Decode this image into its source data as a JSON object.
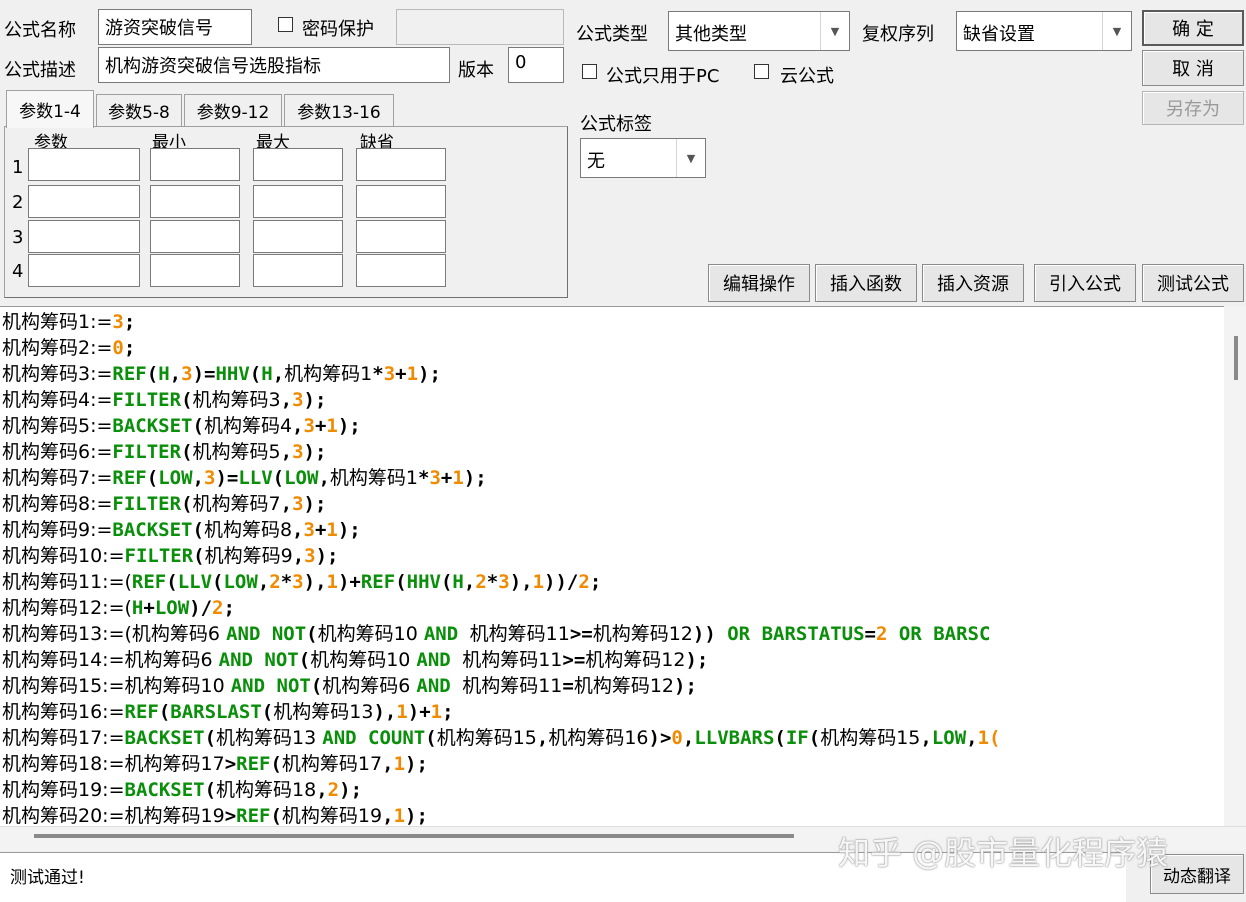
{
  "form": {
    "name_label": "公式名称",
    "name_value": "游资突破信号",
    "password_label": "密码保护",
    "password_checked": false,
    "desc_label": "公式描述",
    "desc_value": "机构游资突破信号选股指标",
    "version_label": "版本",
    "version_value": "0",
    "type_label": "公式类型",
    "type_value": "其他类型",
    "rights_label": "复权序列",
    "rights_value": "缺省设置",
    "pc_only_label": "公式只用于PC",
    "pc_only_checked": false,
    "cloud_label": "云公式",
    "cloud_checked": false,
    "tag_label": "公式标签",
    "tag_value": "无"
  },
  "buttons": {
    "ok": "确  定",
    "cancel": "取  消",
    "save_as": "另存为",
    "edit_ops": "编辑操作",
    "insert_func": "插入函数",
    "insert_res": "插入资源",
    "import_formula": "引入公式",
    "test_formula": "测试公式",
    "dynamic_translate": "动态翻译"
  },
  "tabs": [
    "参数1-4",
    "参数5-8",
    "参数9-12",
    "参数13-16"
  ],
  "params": {
    "headers": [
      "参数",
      "最小",
      "最大",
      "缺省"
    ],
    "rows": [
      "1",
      "2",
      "3",
      "4"
    ]
  },
  "code_lines": [
    [
      [
        "t",
        "机构筹码1:="
      ],
      [
        "n",
        "3"
      ],
      [
        "o",
        ";"
      ]
    ],
    [
      [
        "t",
        "机构筹码2:="
      ],
      [
        "n",
        "0"
      ],
      [
        "o",
        ";"
      ]
    ],
    [
      [
        "t",
        "机构筹码3:="
      ],
      [
        "f",
        "REF"
      ],
      [
        "o",
        "("
      ],
      [
        "f",
        "H"
      ],
      [
        "o",
        ","
      ],
      [
        "n",
        "3"
      ],
      [
        "o",
        ")="
      ],
      [
        "f",
        "HHV"
      ],
      [
        "o",
        "("
      ],
      [
        "f",
        "H"
      ],
      [
        "o",
        ","
      ],
      [
        "t",
        "机构筹码1"
      ],
      [
        "o",
        "*"
      ],
      [
        "n",
        "3"
      ],
      [
        "o",
        "+"
      ],
      [
        "n",
        "1"
      ],
      [
        "o",
        ");"
      ]
    ],
    [
      [
        "t",
        "机构筹码4:="
      ],
      [
        "f",
        "FILTER"
      ],
      [
        "o",
        "("
      ],
      [
        "t",
        "机构筹码3"
      ],
      [
        "o",
        ","
      ],
      [
        "n",
        "3"
      ],
      [
        "o",
        ");"
      ]
    ],
    [
      [
        "t",
        "机构筹码5:="
      ],
      [
        "f",
        "BACKSET"
      ],
      [
        "o",
        "("
      ],
      [
        "t",
        "机构筹码4"
      ],
      [
        "o",
        ","
      ],
      [
        "n",
        "3"
      ],
      [
        "o",
        "+"
      ],
      [
        "n",
        "1"
      ],
      [
        "o",
        ");"
      ]
    ],
    [
      [
        "t",
        "机构筹码6:="
      ],
      [
        "f",
        "FILTER"
      ],
      [
        "o",
        "("
      ],
      [
        "t",
        "机构筹码5"
      ],
      [
        "o",
        ","
      ],
      [
        "n",
        "3"
      ],
      [
        "o",
        ");"
      ]
    ],
    [
      [
        "t",
        "机构筹码7:="
      ],
      [
        "f",
        "REF"
      ],
      [
        "o",
        "("
      ],
      [
        "f",
        "LOW"
      ],
      [
        "o",
        ","
      ],
      [
        "n",
        "3"
      ],
      [
        "o",
        ")="
      ],
      [
        "f",
        "LLV"
      ],
      [
        "o",
        "("
      ],
      [
        "f",
        "LOW"
      ],
      [
        "o",
        ","
      ],
      [
        "t",
        "机构筹码1"
      ],
      [
        "o",
        "*"
      ],
      [
        "n",
        "3"
      ],
      [
        "o",
        "+"
      ],
      [
        "n",
        "1"
      ],
      [
        "o",
        ");"
      ]
    ],
    [
      [
        "t",
        "机构筹码8:="
      ],
      [
        "f",
        "FILTER"
      ],
      [
        "o",
        "("
      ],
      [
        "t",
        "机构筹码7"
      ],
      [
        "o",
        ","
      ],
      [
        "n",
        "3"
      ],
      [
        "o",
        ");"
      ]
    ],
    [
      [
        "t",
        "机构筹码9:="
      ],
      [
        "f",
        "BACKSET"
      ],
      [
        "o",
        "("
      ],
      [
        "t",
        "机构筹码8"
      ],
      [
        "o",
        ","
      ],
      [
        "n",
        "3"
      ],
      [
        "o",
        "+"
      ],
      [
        "n",
        "1"
      ],
      [
        "o",
        ");"
      ]
    ],
    [
      [
        "t",
        "机构筹码10:="
      ],
      [
        "f",
        "FILTER"
      ],
      [
        "o",
        "("
      ],
      [
        "t",
        "机构筹码9"
      ],
      [
        "o",
        ","
      ],
      [
        "n",
        "3"
      ],
      [
        "o",
        ");"
      ]
    ],
    [
      [
        "t",
        "机构筹码11:=("
      ],
      [
        "f",
        "REF"
      ],
      [
        "o",
        "("
      ],
      [
        "f",
        "LLV"
      ],
      [
        "o",
        "("
      ],
      [
        "f",
        "LOW"
      ],
      [
        "o",
        ","
      ],
      [
        "n",
        "2"
      ],
      [
        "o",
        "*"
      ],
      [
        "n",
        "3"
      ],
      [
        "o",
        "),"
      ],
      [
        "n",
        "1"
      ],
      [
        "o",
        ")+"
      ],
      [
        "f",
        "REF"
      ],
      [
        "o",
        "("
      ],
      [
        "f",
        "HHV"
      ],
      [
        "o",
        "("
      ],
      [
        "f",
        "H"
      ],
      [
        "o",
        ","
      ],
      [
        "n",
        "2"
      ],
      [
        "o",
        "*"
      ],
      [
        "n",
        "3"
      ],
      [
        "o",
        "),"
      ],
      [
        "n",
        "1"
      ],
      [
        "o",
        "))/"
      ],
      [
        "n",
        "2"
      ],
      [
        "o",
        ";"
      ]
    ],
    [
      [
        "t",
        "机构筹码12:=("
      ],
      [
        "f",
        "H"
      ],
      [
        "o",
        "+"
      ],
      [
        "f",
        "LOW"
      ],
      [
        "o",
        ")/"
      ],
      [
        "n",
        "2"
      ],
      [
        "o",
        ";"
      ]
    ],
    [
      [
        "t",
        "机构筹码13:=("
      ],
      [
        "t",
        "机构筹码6 "
      ],
      [
        "f",
        "AND"
      ],
      [
        "o",
        " "
      ],
      [
        "f",
        "NOT"
      ],
      [
        "o",
        "("
      ],
      [
        "t",
        "机构筹码10 "
      ],
      [
        "f",
        "AND"
      ],
      [
        "o",
        " "
      ],
      [
        "t",
        "机构筹码11"
      ],
      [
        "o",
        ">="
      ],
      [
        "t",
        "机构筹码12"
      ],
      [
        "o",
        "))"
      ],
      [
        "o",
        " "
      ],
      [
        "f",
        "OR"
      ],
      [
        "o",
        " "
      ],
      [
        "f",
        "BARSTATUS"
      ],
      [
        "o",
        "="
      ],
      [
        "n",
        "2"
      ],
      [
        "o",
        " "
      ],
      [
        "f",
        "OR"
      ],
      [
        "o",
        " "
      ],
      [
        "f",
        "BARSC"
      ]
    ],
    [
      [
        "t",
        "机构筹码14:="
      ],
      [
        "t",
        "机构筹码6 "
      ],
      [
        "f",
        "AND"
      ],
      [
        "o",
        " "
      ],
      [
        "f",
        "NOT"
      ],
      [
        "o",
        "("
      ],
      [
        "t",
        "机构筹码10 "
      ],
      [
        "f",
        "AND"
      ],
      [
        "o",
        " "
      ],
      [
        "t",
        "机构筹码11"
      ],
      [
        "o",
        ">="
      ],
      [
        "t",
        "机构筹码12"
      ],
      [
        "o",
        ");"
      ]
    ],
    [
      [
        "t",
        "机构筹码15:="
      ],
      [
        "t",
        "机构筹码10 "
      ],
      [
        "f",
        "AND"
      ],
      [
        "o",
        " "
      ],
      [
        "f",
        "NOT"
      ],
      [
        "o",
        "("
      ],
      [
        "t",
        "机构筹码6 "
      ],
      [
        "f",
        "AND"
      ],
      [
        "o",
        " "
      ],
      [
        "t",
        "机构筹码11"
      ],
      [
        "o",
        "="
      ],
      [
        "t",
        "机构筹码12"
      ],
      [
        "o",
        ");"
      ]
    ],
    [
      [
        "t",
        "机构筹码16:="
      ],
      [
        "f",
        "REF"
      ],
      [
        "o",
        "("
      ],
      [
        "f",
        "BARSLAST"
      ],
      [
        "o",
        "("
      ],
      [
        "t",
        "机构筹码13"
      ],
      [
        "o",
        "),"
      ],
      [
        "n",
        "1"
      ],
      [
        "o",
        ")+"
      ],
      [
        "n",
        "1"
      ],
      [
        "o",
        ";"
      ]
    ],
    [
      [
        "t",
        "机构筹码17:="
      ],
      [
        "f",
        "BACKSET"
      ],
      [
        "o",
        "("
      ],
      [
        "t",
        "机构筹码13 "
      ],
      [
        "f",
        "AND"
      ],
      [
        "o",
        " "
      ],
      [
        "f",
        "COUNT"
      ],
      [
        "o",
        "("
      ],
      [
        "t",
        "机构筹码15"
      ],
      [
        "o",
        ","
      ],
      [
        "t",
        "机构筹码16"
      ],
      [
        "o",
        ")>"
      ],
      [
        "n",
        "0"
      ],
      [
        "o",
        ","
      ],
      [
        "f",
        "LLVBARS"
      ],
      [
        "o",
        "("
      ],
      [
        "f",
        "IF"
      ],
      [
        "o",
        "("
      ],
      [
        "t",
        "机构筹码15"
      ],
      [
        "o",
        ","
      ],
      [
        "f",
        "LOW"
      ],
      [
        "o",
        ","
      ],
      [
        "n",
        "1("
      ]
    ],
    [
      [
        "t",
        "机构筹码18:="
      ],
      [
        "t",
        "机构筹码17"
      ],
      [
        "o",
        ">"
      ],
      [
        "f",
        "REF"
      ],
      [
        "o",
        "("
      ],
      [
        "t",
        "机构筹码17"
      ],
      [
        "o",
        ","
      ],
      [
        "n",
        "1"
      ],
      [
        "o",
        ");"
      ]
    ],
    [
      [
        "t",
        "机构筹码19:="
      ],
      [
        "f",
        "BACKSET"
      ],
      [
        "o",
        "("
      ],
      [
        "t",
        "机构筹码18"
      ],
      [
        "o",
        ","
      ],
      [
        "n",
        "2"
      ],
      [
        "o",
        ");"
      ]
    ],
    [
      [
        "t",
        "机构筹码20:="
      ],
      [
        "t",
        "机构筹码19"
      ],
      [
        "o",
        ">"
      ],
      [
        "f",
        "REF"
      ],
      [
        "o",
        "("
      ],
      [
        "t",
        "机构筹码19"
      ],
      [
        "o",
        ","
      ],
      [
        "n",
        "1"
      ],
      [
        "o",
        ");"
      ]
    ]
  ],
  "status_text": "测试通过!",
  "watermark": "知乎 @股市量化程序猿"
}
